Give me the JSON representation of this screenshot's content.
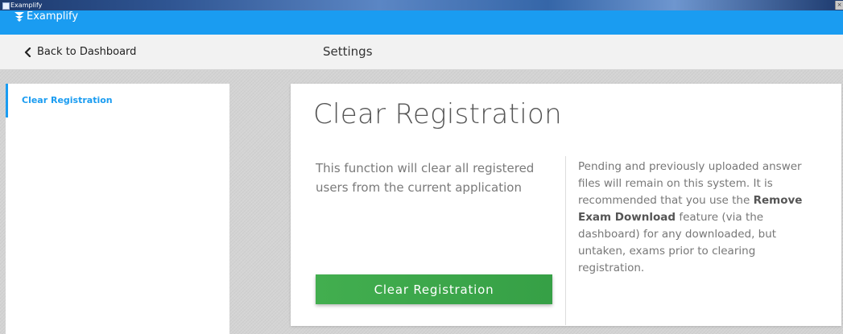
{
  "window": {
    "title": "Examplify"
  },
  "brand": {
    "name": "Examplify",
    "color": "#1a9cf1"
  },
  "header": {
    "back_label": "Back to Dashboard",
    "page_title": "Settings"
  },
  "sidebar": {
    "items": [
      {
        "label": "Clear Registration",
        "active": true
      }
    ]
  },
  "card": {
    "title": "Clear Registration",
    "description": "This function will clear all registered users from the current application",
    "button_label": "Clear Registration",
    "button_color": "#3ca84b",
    "note": {
      "before": "Pending and previously uploaded answer files will remain on this system. It is recommended that you use the ",
      "emphasis": "Remove Exam Download",
      "after": " feature (via the dashboard) for any downloaded, but untaken, exams prior to clearing registration."
    }
  },
  "icons": {
    "back": "chevron-left-icon",
    "logo": "examplify-logo-icon",
    "window": "app-window-icon"
  }
}
